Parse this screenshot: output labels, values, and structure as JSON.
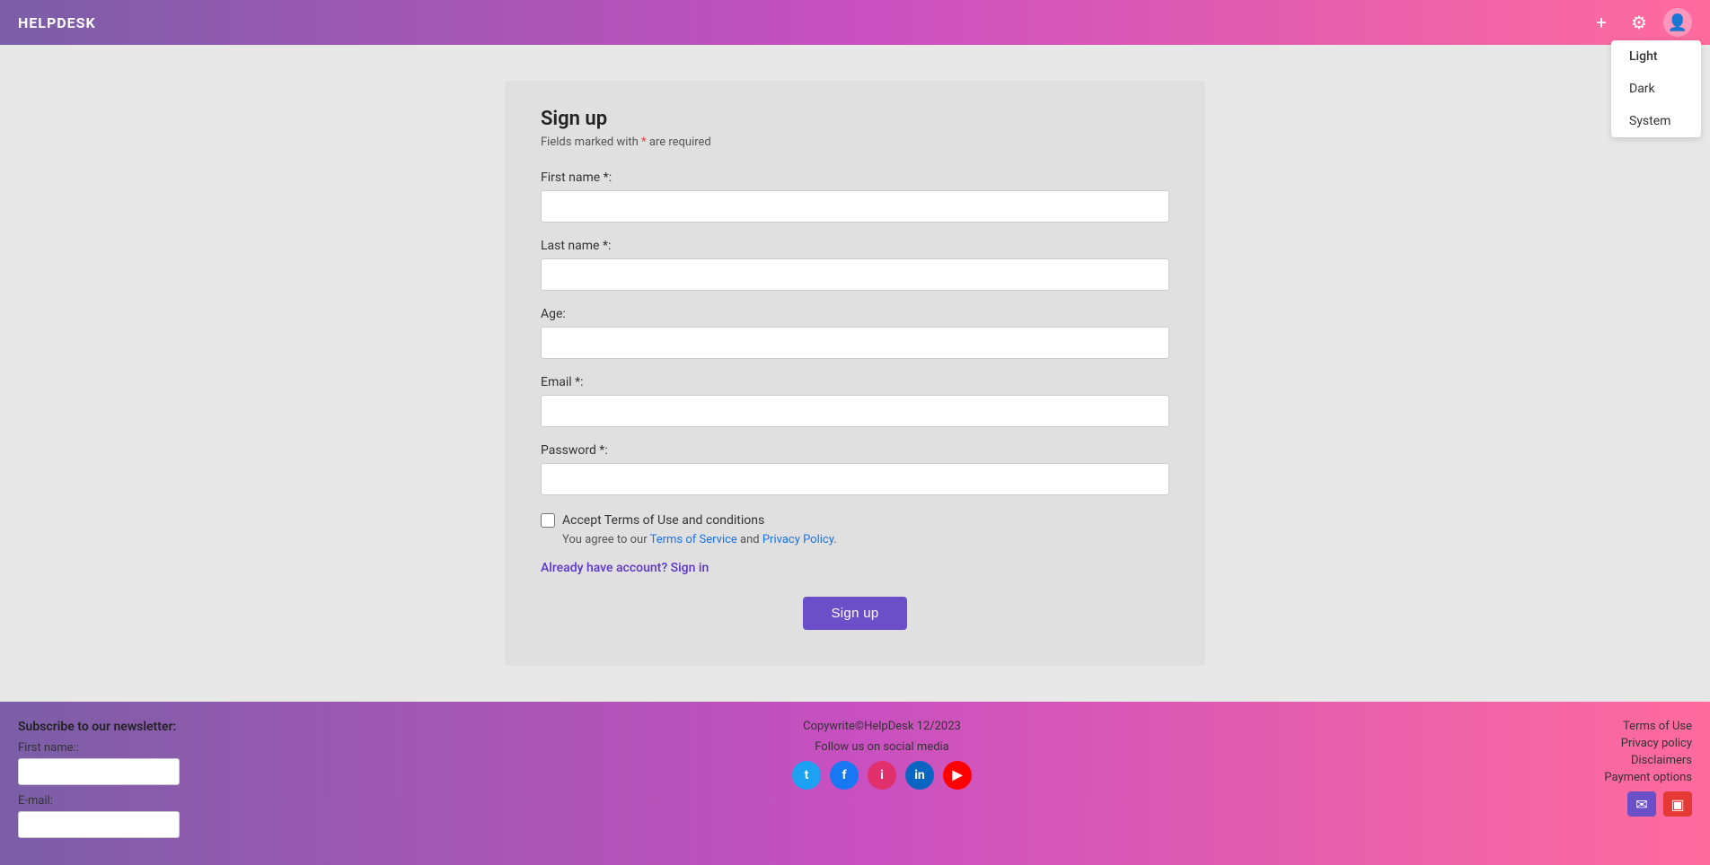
{
  "header": {
    "logo": "HELPDESK",
    "plus_icon": "+",
    "settings_icon": "⚙",
    "avatar_icon": "👤"
  },
  "theme_dropdown": {
    "items": [
      {
        "label": "Light",
        "active": true
      },
      {
        "label": "Dark",
        "active": false
      },
      {
        "label": "System",
        "active": false
      }
    ]
  },
  "form": {
    "title": "Sign up",
    "subtitle_prefix": "Fields marked with ",
    "subtitle_star": "*",
    "subtitle_suffix": " are required",
    "first_name_label": "First name *:",
    "last_name_label": "Last name *:",
    "age_label": "Age:",
    "email_label": "Email *:",
    "password_label": "Password *:",
    "checkbox_label": "Accept Terms of Use and conditions",
    "agreement_prefix": "You agree to our ",
    "terms_link": "Terms of Service",
    "agreement_and": " and ",
    "privacy_link": "Privacy Policy",
    "agreement_suffix": ".",
    "signin_link": "Already have account? Sign in",
    "signup_button": "Sign up"
  },
  "footer": {
    "newsletter_title": "Subscribe to our newsletter:",
    "first_name_label": "First name::",
    "email_label": "E-mail:",
    "copyright": "Copywrite©HelpDesk 12/2023",
    "social_title": "Follow us on social media",
    "social_icons": [
      {
        "name": "twitter",
        "symbol": "t"
      },
      {
        "name": "facebook",
        "symbol": "f"
      },
      {
        "name": "instagram",
        "symbol": "i"
      },
      {
        "name": "linkedin",
        "symbol": "in"
      },
      {
        "name": "youtube",
        "symbol": "▶"
      }
    ],
    "links": [
      "Terms of Use",
      "Privacy policy",
      "Disclaimers",
      "Payment options"
    ]
  }
}
